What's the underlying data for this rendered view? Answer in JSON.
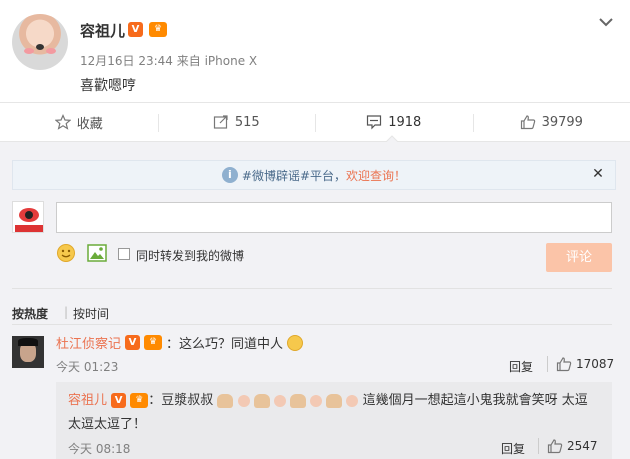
{
  "post": {
    "author": "容祖儿",
    "verified_badge": "V",
    "member_badge": "会员",
    "meta": "12月16日 23:44  来自 iPhone X",
    "text": "喜歡嗯哼"
  },
  "actions": {
    "favorite_label": "收藏",
    "repost_count": "515",
    "comment_count": "1918",
    "like_count": "39799"
  },
  "notice": {
    "prefix": "#微博辟谣#平台，",
    "link": "欢迎查询！"
  },
  "composer": {
    "sync_label": "同时转发到我的微博",
    "submit_label": "评论"
  },
  "sort": {
    "hot": "按热度",
    "sep": "|",
    "time": "按时间"
  },
  "comment": {
    "author": "杜江侦察记",
    "text": "：这么巧？同道中人",
    "time": "今天 01:23",
    "reply_label": "回复",
    "likes": "17087"
  },
  "reply": {
    "author": "容祖儿",
    "text_a": "：豆漿叔叔",
    "text_b": "這幾個月一想起這小鬼我就會笑呀 太逗太逗太逗了！",
    "time": "今天 08:18",
    "reply_label": "回复",
    "likes": "2547"
  },
  "colors": {
    "accent": "#eb7350",
    "submit_disabled": "#fbc4a8",
    "panel_bg": "#f2f2f5",
    "notice_bg": "#eef3f8"
  }
}
